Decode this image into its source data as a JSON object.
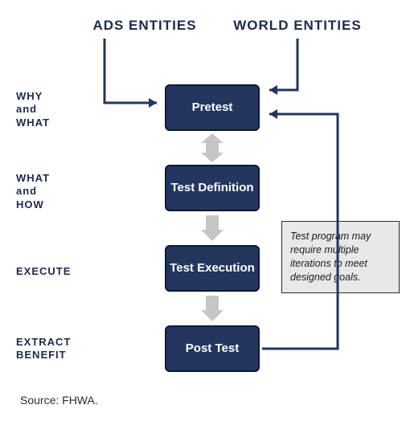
{
  "headers": {
    "left": "ADS ENTITIES",
    "right": "WORLD ENTITIES"
  },
  "side_labels": {
    "why_what_1": "WHY",
    "why_what_2": "and",
    "why_what_3": "WHAT",
    "what_how_1": "WHAT",
    "what_how_2": "and",
    "what_how_3": "HOW",
    "execute": "EXECUTE",
    "extract_1": "EXTRACT",
    "extract_2": "BENEFIT"
  },
  "stages": {
    "pretest": "Pretest",
    "definition": "Test Definition",
    "execution": "Test Execution",
    "posttest": "Post Test"
  },
  "callout": "Test program may require multiple iterations to meet designed goals.",
  "source": "Source: FHWA.",
  "diagram_structure": {
    "inputs": [
      "ADS ENTITIES",
      "WORLD ENTITIES"
    ],
    "flow": [
      "Pretest",
      "Test Definition",
      "Test Execution",
      "Post Test"
    ],
    "bidirectional_between": [
      "Pretest",
      "Test Definition"
    ],
    "feedback_loop": {
      "from": "Post Test",
      "to": "Pretest",
      "note_ref": "callout"
    }
  }
}
